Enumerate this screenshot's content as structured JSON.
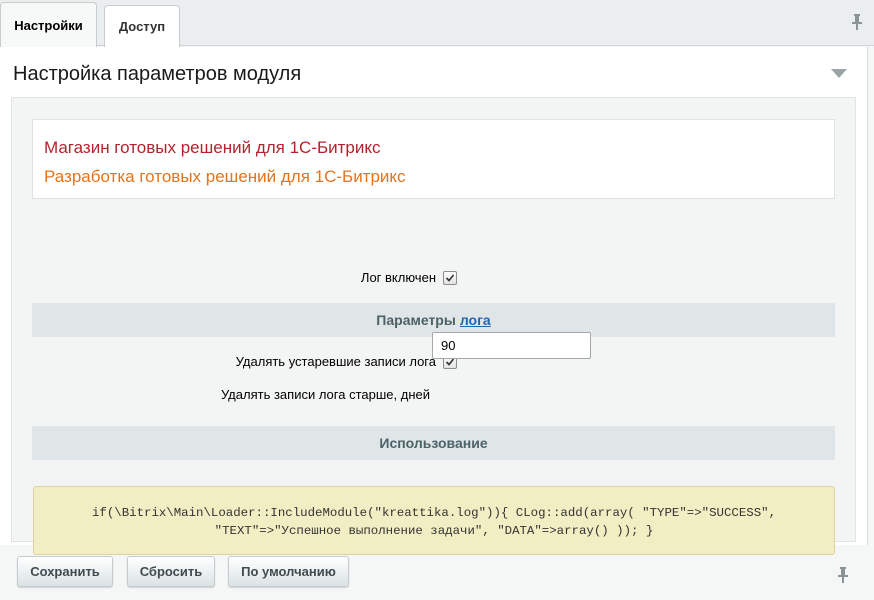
{
  "tabs": [
    {
      "label": "Настройки",
      "active": true
    },
    {
      "label": "Доступ",
      "active": false
    }
  ],
  "panel": {
    "title": "Настройка параметров модуля"
  },
  "banner": {
    "line1": "Магазин готовых решений для 1С-Битрикс",
    "line2": "Разработка готовых решений для 1С-Битрикс",
    "line1_color": "#b4222e",
    "line2_color": "#e5731c"
  },
  "settings": {
    "log_enabled_label": "Лог включен",
    "log_enabled": true,
    "params_section_prefix": "Параметры",
    "params_section_link": "лога",
    "delete_old_label": "Удалять устаревшие записи лога",
    "delete_old": true,
    "delete_days_label": "Удалять записи лога старше, дней",
    "delete_days_value": "90",
    "usage_section": "Использование"
  },
  "code": {
    "line1": "if(\\Bitrix\\Main\\Loader::IncludeModule(\"kreattika.log\")){ CLog::add(array( \"TYPE\"=>\"SUCCESS\",",
    "line2": "\"TEXT\"=>\"Успешное выполнение задачи\", \"DATA\"=>array() )); }"
  },
  "buttons": {
    "save": "Сохранить",
    "reset": "Сбросить",
    "default": "По умолчанию"
  },
  "icons": {
    "pin": "pin-icon",
    "collapse": "chevron-down-icon",
    "check": "checkmark-icon"
  },
  "colors": {
    "section_bg": "#e0e6e7",
    "link": "#2067b0",
    "code_bg": "#f2eec3"
  }
}
